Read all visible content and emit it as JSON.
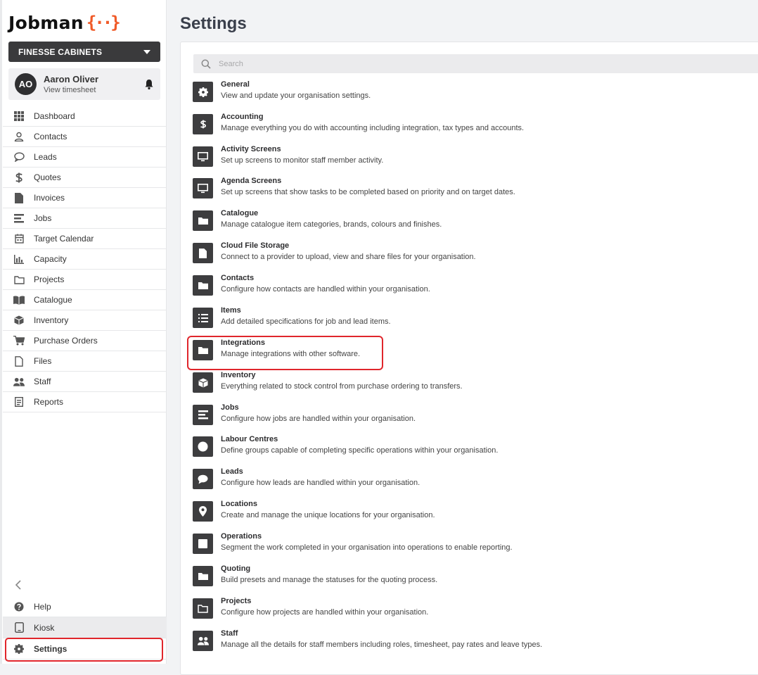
{
  "brand": {
    "wordmark": "Jobman",
    "mark": "{··}"
  },
  "org_selector": {
    "label": "FINESSE CABINETS"
  },
  "user": {
    "initials": "AO",
    "name": "Aaron Oliver",
    "subtitle": "View timesheet"
  },
  "nav": [
    {
      "label": "Dashboard",
      "icon": "grid-icon"
    },
    {
      "label": "Contacts",
      "icon": "user-icon"
    },
    {
      "label": "Leads",
      "icon": "chat-bubble-icon"
    },
    {
      "label": "Quotes",
      "icon": "dollar-icon"
    },
    {
      "label": "Invoices",
      "icon": "document-icon"
    },
    {
      "label": "Jobs",
      "icon": "lines-icon"
    },
    {
      "label": "Target Calendar",
      "icon": "calendar-icon"
    },
    {
      "label": "Capacity",
      "icon": "bar-chart-icon"
    },
    {
      "label": "Projects",
      "icon": "folder-outline-icon"
    },
    {
      "label": "Catalogue",
      "icon": "book-open-icon"
    },
    {
      "label": "Inventory",
      "icon": "box-icon"
    },
    {
      "label": "Purchase Orders",
      "icon": "cart-icon"
    },
    {
      "label": "Files",
      "icon": "file-outline-icon"
    },
    {
      "label": "Staff",
      "icon": "people-icon"
    },
    {
      "label": "Reports",
      "icon": "report-icon"
    }
  ],
  "bottom_nav": [
    {
      "label": "Help",
      "icon": "question-circle-icon"
    },
    {
      "label": "Kiosk",
      "icon": "tablet-icon"
    },
    {
      "label": "Settings",
      "icon": "gear-icon"
    }
  ],
  "page_title": "Settings",
  "search": {
    "placeholder": "Search",
    "value": ""
  },
  "settings_items": [
    {
      "title": "General",
      "description": "View and update your organisation settings.",
      "icon": "gear-icon"
    },
    {
      "title": "Accounting",
      "description": "Manage everything you do with accounting including integration, tax types and accounts.",
      "icon": "dollar-icon"
    },
    {
      "title": "Activity Screens",
      "description": "Set up screens to monitor staff member activity.",
      "icon": "monitor-icon"
    },
    {
      "title": "Agenda Screens",
      "description": "Set up screens that show tasks to be completed based on priority and on target dates.",
      "icon": "monitor-icon"
    },
    {
      "title": "Catalogue",
      "description": "Manage catalogue item categories, brands, colours and finishes.",
      "icon": "folder-icon"
    },
    {
      "title": "Cloud File Storage",
      "description": "Connect to a provider to upload, view and share files for your organisation.",
      "icon": "file-icon"
    },
    {
      "title": "Contacts",
      "description": "Configure how contacts are handled within your organisation.",
      "icon": "folder-icon"
    },
    {
      "title": "Items",
      "description": "Add detailed specifications for job and lead items.",
      "icon": "list-icon"
    },
    {
      "title": "Integrations",
      "description": "Manage integrations with other software.",
      "icon": "folder-icon"
    },
    {
      "title": "Inventory",
      "description": "Everything related to stock control from purchase ordering to transfers.",
      "icon": "box-icon"
    },
    {
      "title": "Jobs",
      "description": "Configure how jobs are handled within your organisation.",
      "icon": "lines-icon"
    },
    {
      "title": "Labour Centres",
      "description": "Define groups capable of completing specific operations within your organisation.",
      "icon": "circle-icon"
    },
    {
      "title": "Leads",
      "description": "Configure how leads are handled within your organisation.",
      "icon": "chat-bubble-icon"
    },
    {
      "title": "Locations",
      "description": "Create and manage the unique locations for your organisation.",
      "icon": "map-pin-icon"
    },
    {
      "title": "Operations",
      "description": "Segment the work completed in your organisation into operations to enable reporting.",
      "icon": "square-icon"
    },
    {
      "title": "Quoting",
      "description": "Build presets and manage the statuses for the quoting process.",
      "icon": "folder-icon"
    },
    {
      "title": "Projects",
      "description": "Configure how projects are handled within your organisation.",
      "icon": "folder-outline-icon"
    },
    {
      "title": "Staff",
      "description": "Manage all the details for staff members including roles, timesheet, pay rates and leave types.",
      "icon": "people-icon"
    }
  ],
  "colors": {
    "brand_accent": "#f05a28",
    "highlight": "#e0262c",
    "dark_tile": "#3d3d3f"
  }
}
